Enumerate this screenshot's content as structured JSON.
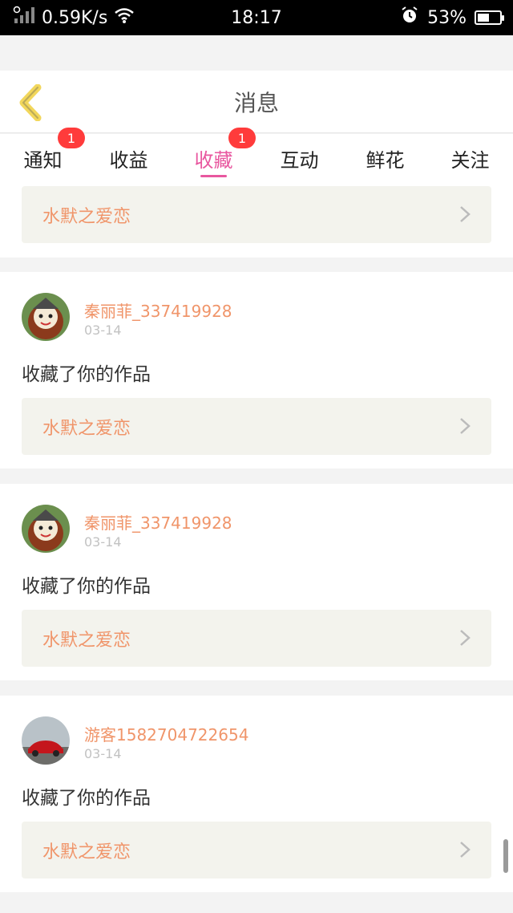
{
  "status_bar": {
    "net_speed": "0.59K/s",
    "time": "18:17",
    "battery": "53%",
    "battery_level": 0.53,
    "icons": [
      "signal-icon",
      "wifi-icon",
      "alarm-icon",
      "battery-icon"
    ]
  },
  "header": {
    "title": "消息",
    "back_icon": "chevron-left-icon"
  },
  "tabs": [
    {
      "label": "通知",
      "badge": "1"
    },
    {
      "label": "收益",
      "badge": ""
    },
    {
      "label": "收藏",
      "badge": "1",
      "active": true
    },
    {
      "label": "互动",
      "badge": ""
    },
    {
      "label": "鲜花",
      "badge": ""
    },
    {
      "label": "关注",
      "badge": ""
    }
  ],
  "items": [
    {
      "work_title": "水默之爱恋"
    },
    {
      "username": "秦丽菲_337419928",
      "date": "03-14",
      "action": "收藏了你的作品",
      "work_title": "水默之爱恋"
    },
    {
      "username": "秦丽菲_337419928",
      "date": "03-14",
      "action": "收藏了你的作品",
      "work_title": "水默之爱恋"
    },
    {
      "username": "游客1582704722654",
      "date": "03-14",
      "action": "收藏了你的作品",
      "work_title": "水默之爱恋"
    }
  ],
  "colors": {
    "accent_pink": "#e8579f",
    "name_orange": "#f0956a",
    "badge_red": "#ff3b3b",
    "back_yellow": "#f2d75c"
  }
}
